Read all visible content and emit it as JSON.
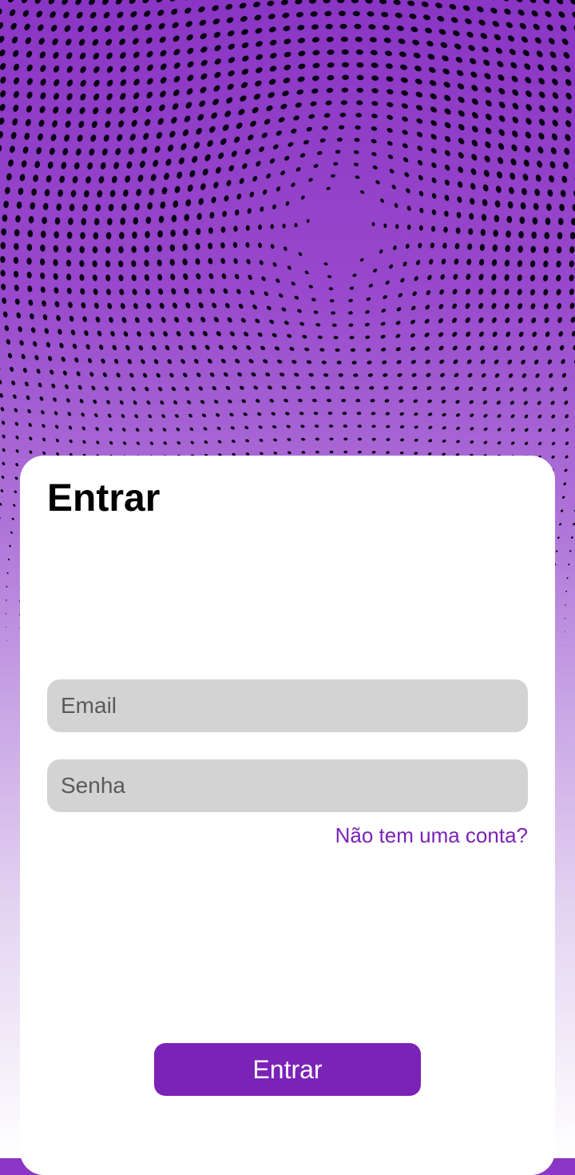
{
  "login": {
    "title": "Entrar",
    "email_placeholder": "Email",
    "email_value": "",
    "password_placeholder": "Senha",
    "password_value": "",
    "signup_link": "Não tem uma conta?",
    "submit_label": "Entrar"
  },
  "colors": {
    "brand_purple": "#7b22b7",
    "field_background": "#d4d3d4",
    "link_purple": "#7a22b8"
  },
  "icons": {
    "background": "purple-halftone-wave-pattern"
  }
}
